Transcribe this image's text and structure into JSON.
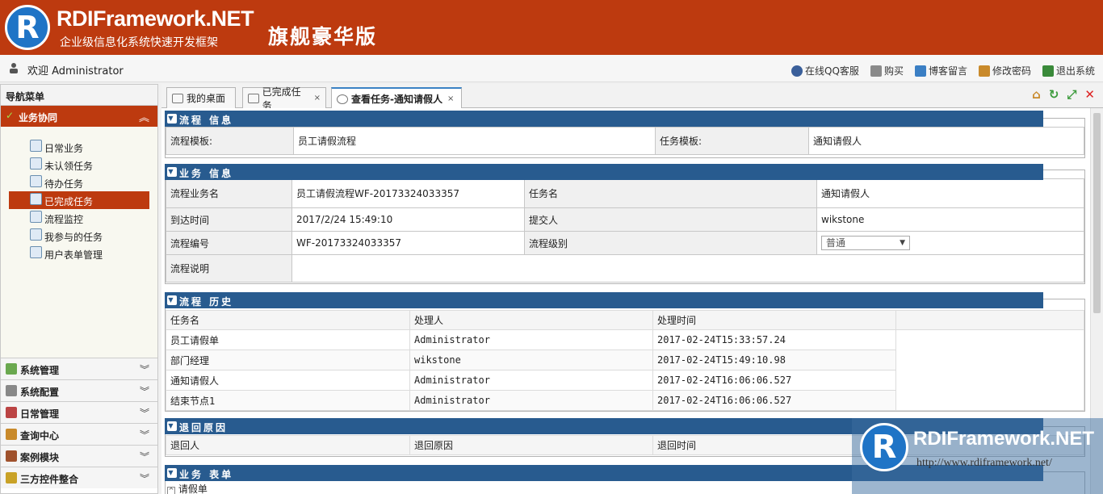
{
  "header": {
    "logo_letter": "R",
    "brand": "RDIFramework.NET",
    "subtitle": "企业级信息化系统快速开发框架",
    "edition": "旗舰豪华版"
  },
  "welcome": {
    "text": "欢迎 Administrator"
  },
  "toplinks": [
    {
      "label": "在线QQ客服",
      "icon": "qq-icon",
      "color": "#3a5f9a"
    },
    {
      "label": "购买",
      "icon": "cart-icon",
      "color": "#8a8a8a"
    },
    {
      "label": "博客留言",
      "icon": "mail-icon",
      "color": "#3b7fc4"
    },
    {
      "label": "修改密码",
      "icon": "key-icon",
      "color": "#c98a2b"
    },
    {
      "label": "退出系统",
      "icon": "logout-icon",
      "color": "#3a8a3a"
    }
  ],
  "sidebar": {
    "title": "导航菜单",
    "active_group": "业务协同",
    "items": [
      {
        "label": "日常业务",
        "selected": false
      },
      {
        "label": "未认领任务",
        "selected": false
      },
      {
        "label": "待办任务",
        "selected": false
      },
      {
        "label": "已完成任务",
        "selected": true
      },
      {
        "label": "流程监控",
        "selected": false
      },
      {
        "label": "我参与的任务",
        "selected": false
      },
      {
        "label": "用户表单管理",
        "selected": false
      }
    ],
    "groups": [
      {
        "label": "系统管理",
        "color": "#6aa84f"
      },
      {
        "label": "系统配置",
        "color": "#888888"
      },
      {
        "label": "日常管理",
        "color": "#b44"
      },
      {
        "label": "查询中心",
        "color": "#c98a2b"
      },
      {
        "label": "案例模块",
        "color": "#a0522d"
      },
      {
        "label": "三方控件整合",
        "color": "#c9a227"
      }
    ]
  },
  "tabs": [
    {
      "label": "我的桌面",
      "closable": false
    },
    {
      "label": "已完成任务",
      "closable": true
    },
    {
      "label": "查看任务-通知请假人",
      "closable": true,
      "active": true
    }
  ],
  "tab_close_glyph": "×",
  "process_info": {
    "title": "流程 信息",
    "template_label": "流程模板:",
    "template_value": "员工请假流程",
    "task_template_label": "任务模板:",
    "task_template_value": "通知请假人"
  },
  "business_info": {
    "title": "业务 信息",
    "business_name_label": "流程业务名",
    "business_name_value": "员工请假流程WF-20173324033357",
    "task_name_label": "任务名",
    "task_name_value": "通知请假人",
    "arrive_label": "到达时间",
    "arrive_value": "2017/2/24 15:49:10",
    "submitter_label": "提交人",
    "submitter_value": "wikstone",
    "flow_no_label": "流程编号",
    "flow_no_value": "WF-20173324033357",
    "level_label": "流程级别",
    "level_value": "普通",
    "desc_label": "流程说明",
    "desc_value": ""
  },
  "history": {
    "title": "流程 历史",
    "headers": [
      "任务名",
      "处理人",
      "处理时间"
    ],
    "rows": [
      [
        "员工请假单",
        "Administrator",
        "2017-02-24T15:33:57.24"
      ],
      [
        "部门经理",
        "wikstone",
        "2017-02-24T15:49:10.98"
      ],
      [
        "通知请假人",
        "Administrator",
        "2017-02-24T16:06:06.527"
      ],
      [
        "结束节点1",
        "Administrator",
        "2017-02-24T16:06:06.527"
      ]
    ]
  },
  "return_reason": {
    "title": "退回原因",
    "headers": [
      "退回人",
      "退回原因",
      "退回时间"
    ]
  },
  "business_form": {
    "title": "业务 表单",
    "item": "请假单"
  },
  "watermark": {
    "logo_letter": "R",
    "brand": "RDIFramework.NET",
    "url": "http://www.rdiframework.net/"
  }
}
